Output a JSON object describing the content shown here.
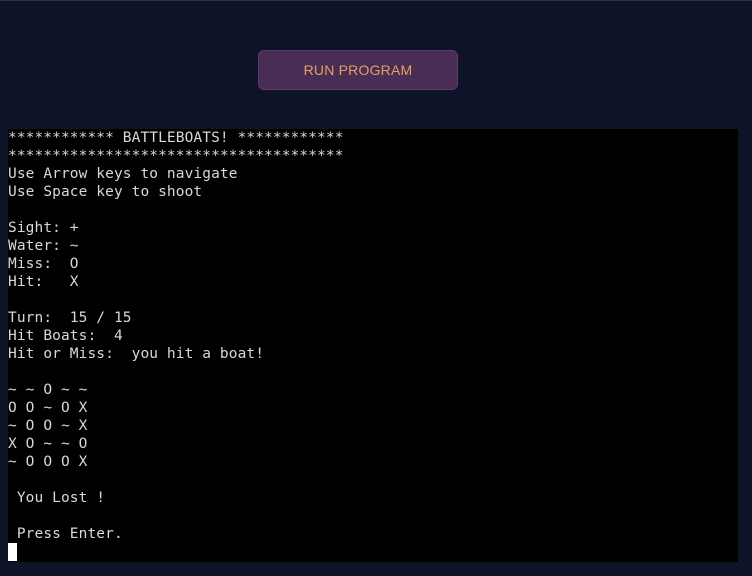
{
  "toolbar": {
    "run_label": "RUN PROGRAM"
  },
  "terminal": {
    "lines": [
      "************ BATTLEBOATS! ************",
      "**************************************",
      "Use Arrow keys to navigate",
      "Use Space key to shoot",
      "",
      "Sight: +",
      "Water: ~",
      "Miss:  O",
      "Hit:   X",
      "",
      "Turn:  15 / 15",
      "Hit Boats:  4",
      "Hit or Miss:  you hit a boat!",
      "",
      "~ ~ O ~ ~",
      "O O ~ O X",
      "~ O O ~ X",
      "X O ~ ~ O",
      "~ O O O X",
      "",
      " You Lost !",
      "",
      " Press Enter."
    ]
  },
  "colors": {
    "page_background": "#0e1327",
    "button_background": "#4a2d55",
    "button_text": "#e5a05f",
    "terminal_background": "#000000",
    "terminal_text": "#d8d8d8"
  }
}
